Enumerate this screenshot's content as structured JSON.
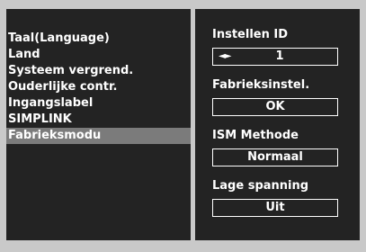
{
  "menu": {
    "items": [
      {
        "label": "Taal(Language)"
      },
      {
        "label": "Land"
      },
      {
        "label": "Systeem vergrend."
      },
      {
        "label": "Ouderlijke contr."
      },
      {
        "label": "Ingangslabel"
      },
      {
        "label": "SIMPLINK"
      },
      {
        "label": "Fabrieksmodu",
        "selected": true
      }
    ]
  },
  "settings": {
    "instellen_id": {
      "label": "Instellen ID",
      "arrows": "◄►",
      "value": "1"
    },
    "fabrieksinstel": {
      "label": "Fabrieksinstel.",
      "value": "OK"
    },
    "ism_methode": {
      "label": "ISM Methode",
      "value": "Normaal"
    },
    "lage_spanning": {
      "label": "Lage spanning",
      "value": "Uit"
    }
  },
  "colors": {
    "frame": "#c9c9c9",
    "panel": "#232323",
    "highlight": "#7b7b7b",
    "text": "#ffffff"
  }
}
